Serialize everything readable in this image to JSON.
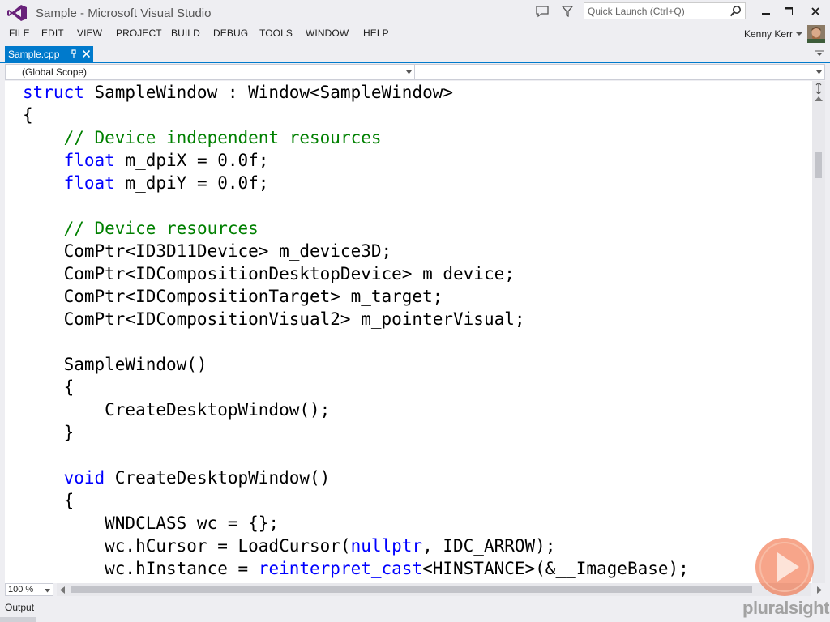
{
  "window": {
    "title": "Sample - Microsoft Visual Studio",
    "quick_launch_placeholder": "Quick Launch (Ctrl+Q)",
    "user_name": "Kenny Kerr"
  },
  "menu": [
    "FILE",
    "EDIT",
    "VIEW",
    "PROJECT",
    "BUILD",
    "DEBUG",
    "TOOLS",
    "WINDOW",
    "HELP"
  ],
  "tab": {
    "label": "Sample.cpp"
  },
  "navigation": {
    "scope": "(Global Scope)",
    "member": ""
  },
  "editor": {
    "zoom": "100 %",
    "lines": [
      [
        {
          "t": "struct",
          "c": "kw"
        },
        {
          "t": " SampleWindow : Window<SampleWindow>"
        }
      ],
      [
        {
          "t": "{"
        }
      ],
      [
        {
          "t": "    "
        },
        {
          "t": "// Device independent resources",
          "c": "cm"
        }
      ],
      [
        {
          "t": "    "
        },
        {
          "t": "float",
          "c": "kw"
        },
        {
          "t": " m_dpiX = 0.0f;"
        }
      ],
      [
        {
          "t": "    "
        },
        {
          "t": "float",
          "c": "kw"
        },
        {
          "t": " m_dpiY = 0.0f;"
        }
      ],
      [],
      [
        {
          "t": "    "
        },
        {
          "t": "// Device resources",
          "c": "cm"
        }
      ],
      [
        {
          "t": "    ComPtr<ID3D11Device> m_device3D;"
        }
      ],
      [
        {
          "t": "    ComPtr<IDCompositionDesktopDevice> m_device;"
        }
      ],
      [
        {
          "t": "    ComPtr<IDCompositionTarget> m_target;"
        }
      ],
      [
        {
          "t": "    ComPtr<IDCompositionVisual2> m_pointerVisual;"
        }
      ],
      [],
      [
        {
          "t": "    SampleWindow()"
        }
      ],
      [
        {
          "t": "    {"
        }
      ],
      [
        {
          "t": "        CreateDesktopWindow();"
        }
      ],
      [
        {
          "t": "    }"
        }
      ],
      [],
      [
        {
          "t": "    "
        },
        {
          "t": "void",
          "c": "kw"
        },
        {
          "t": " CreateDesktopWindow()"
        }
      ],
      [
        {
          "t": "    {"
        }
      ],
      [
        {
          "t": "        WNDCLASS wc = {};"
        }
      ],
      [
        {
          "t": "        wc.hCursor = LoadCursor("
        },
        {
          "t": "nullptr",
          "c": "kw"
        },
        {
          "t": ", IDC_ARROW);"
        }
      ],
      [
        {
          "t": "        wc.hInstance = "
        },
        {
          "t": "reinterpret_cast",
          "c": "kw"
        },
        {
          "t": "<HINSTANCE>(&__ImageBase);"
        }
      ]
    ]
  },
  "output_panel": {
    "label": "Output"
  },
  "watermark": {
    "text": "pluralsight"
  },
  "colors": {
    "accent": "#007acc",
    "keyword": "#0000ff",
    "comment": "#008000",
    "logo": "#68217a",
    "watermark_play": "#f15b2a"
  }
}
